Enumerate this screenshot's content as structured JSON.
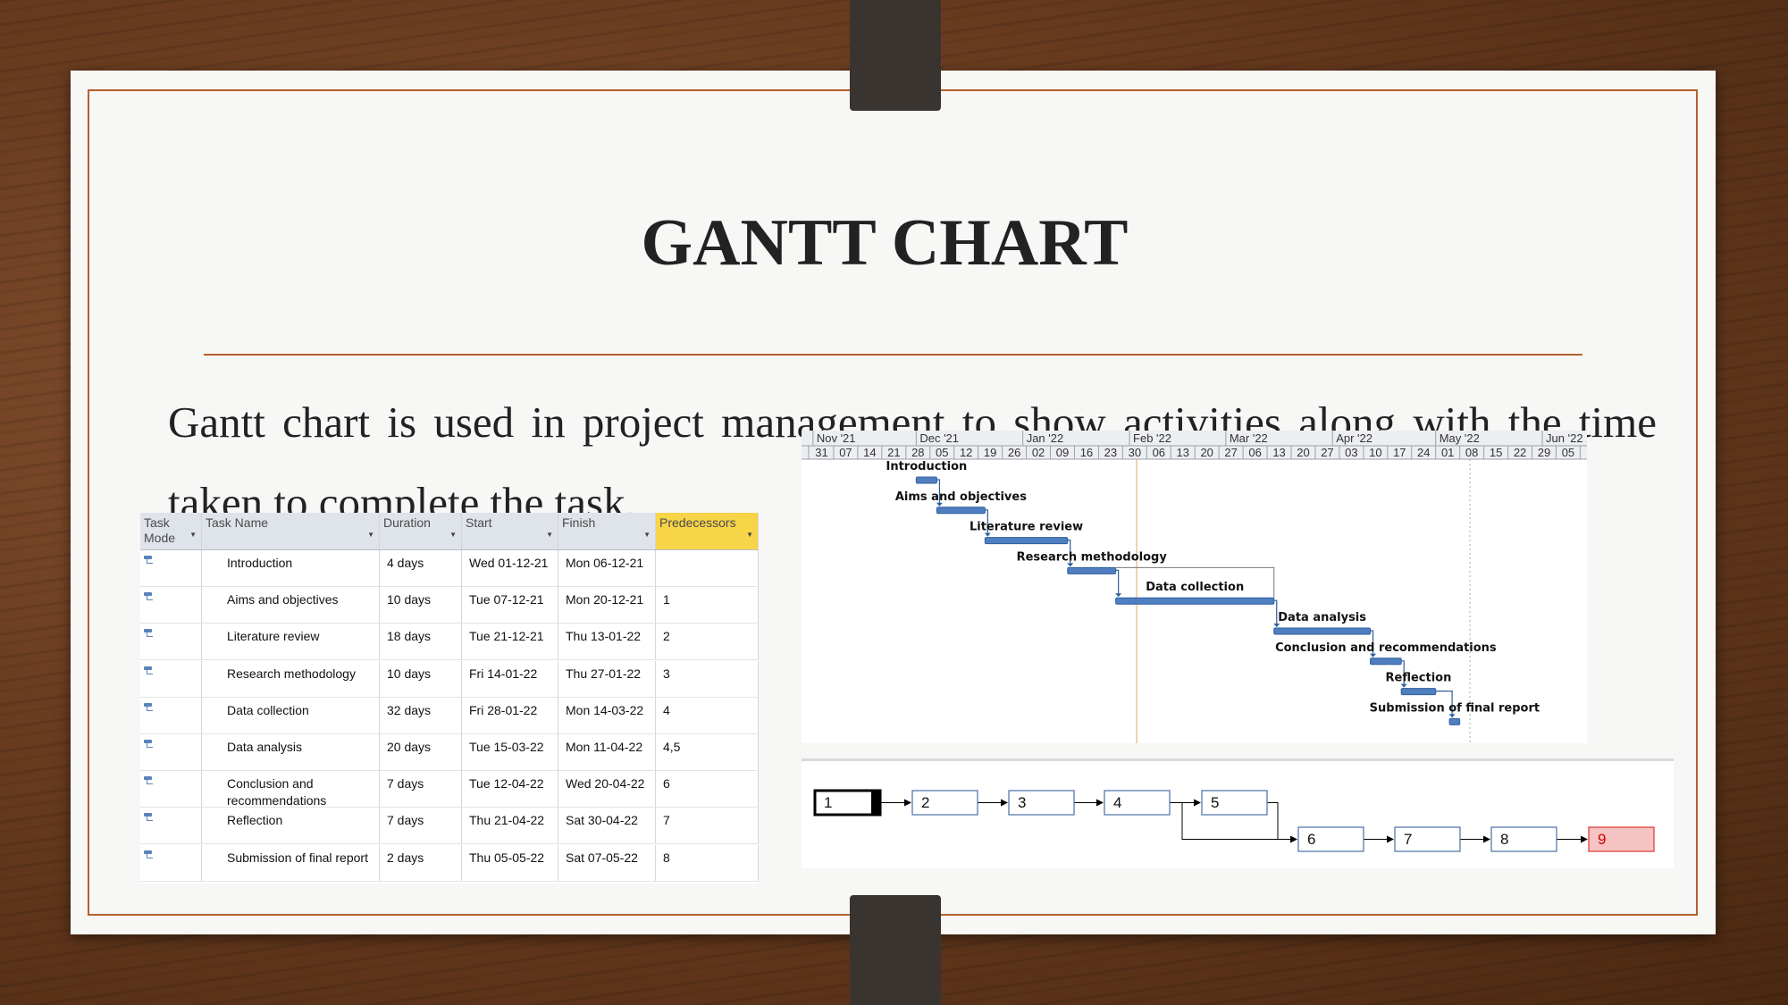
{
  "slide": {
    "title": "GANTT CHART",
    "paragraph": "Gantt chart is used in project management to show activities along with the time taken to complete the task."
  },
  "colors": {
    "frame": "#b5612a",
    "bar": "#4f7fc1",
    "predecessors_header": "#f7d448",
    "critical_node": "#f6c3c3"
  },
  "table": {
    "headers": {
      "mode": "Task Mode",
      "name": "Task Name",
      "duration": "Duration",
      "start": "Start",
      "finish": "Finish",
      "predecessors": "Predecessors"
    },
    "rows": [
      {
        "name": "Introduction",
        "duration": "4 days",
        "start": "Wed 01-12-21",
        "finish": "Mon 06-12-21",
        "pred": ""
      },
      {
        "name": "Aims and objectives",
        "duration": "10 days",
        "start": "Tue 07-12-21",
        "finish": "Mon 20-12-21",
        "pred": "1"
      },
      {
        "name": "Literature review",
        "duration": "18 days",
        "start": "Tue 21-12-21",
        "finish": "Thu 13-01-22",
        "pred": "2"
      },
      {
        "name": "Research methodology",
        "duration": "10 days",
        "start": "Fri 14-01-22",
        "finish": "Thu 27-01-22",
        "pred": "3"
      },
      {
        "name": "Data collection",
        "duration": "32 days",
        "start": "Fri 28-01-22",
        "finish": "Mon 14-03-22",
        "pred": "4"
      },
      {
        "name": "Data analysis",
        "duration": "20 days",
        "start": "Tue 15-03-22",
        "finish": "Mon 11-04-22",
        "pred": "4,5"
      },
      {
        "name": "Conclusion and recommendations",
        "duration": "7 days",
        "start": "Tue 12-04-22",
        "finish": "Wed 20-04-22",
        "pred": "6"
      },
      {
        "name": "Reflection",
        "duration": "7 days",
        "start": "Thu 21-04-22",
        "finish": "Sat 30-04-22",
        "pred": "7"
      },
      {
        "name": "Submission of final report",
        "duration": "2 days",
        "start": "Thu 05-05-22",
        "finish": "Sat 07-05-22",
        "pred": "8"
      }
    ]
  },
  "chart_data": {
    "type": "gantt",
    "months": [
      "Nov '21",
      "Dec '21",
      "Jan '22",
      "Feb '22",
      "Mar '22",
      "Apr '22",
      "May '22",
      "Jun '22"
    ],
    "week_ticks": [
      "31",
      "07",
      "14",
      "21",
      "28",
      "05",
      "12",
      "19",
      "26",
      "02",
      "09",
      "16",
      "23",
      "30",
      "06",
      "13",
      "20",
      "27",
      "06",
      "13",
      "20",
      "27",
      "03",
      "10",
      "17",
      "24",
      "01",
      "08",
      "15",
      "22",
      "29",
      "05"
    ],
    "tasks": [
      {
        "name": "Introduction",
        "start": "2021-12-01",
        "finish": "2021-12-06"
      },
      {
        "name": "Aims and objectives",
        "start": "2021-12-07",
        "finish": "2021-12-20"
      },
      {
        "name": "Literature review",
        "start": "2021-12-21",
        "finish": "2022-01-13"
      },
      {
        "name": "Research methodology",
        "start": "2022-01-14",
        "finish": "2022-01-27"
      },
      {
        "name": "Data collection",
        "start": "2022-01-28",
        "finish": "2022-03-14"
      },
      {
        "name": "Data analysis",
        "start": "2022-03-15",
        "finish": "2022-04-11"
      },
      {
        "name": "Conclusion and recommendations",
        "start": "2022-04-12",
        "finish": "2022-04-20"
      },
      {
        "name": "Reflection",
        "start": "2022-04-21",
        "finish": "2022-04-30"
      },
      {
        "name": "Submission of final report",
        "start": "2022-05-05",
        "finish": "2022-05-07"
      }
    ]
  },
  "network": {
    "nodes": [
      "1",
      "2",
      "3",
      "4",
      "5",
      "6",
      "7",
      "8",
      "9"
    ]
  }
}
